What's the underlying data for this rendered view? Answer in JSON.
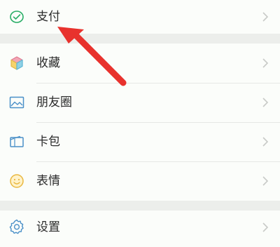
{
  "menu": {
    "items": [
      {
        "label": "支付",
        "icon": "pay-check-icon"
      },
      {
        "label": "收藏",
        "icon": "cube-icon"
      },
      {
        "label": "朋友圈",
        "icon": "image-icon"
      },
      {
        "label": "卡包",
        "icon": "wallet-icon"
      },
      {
        "label": "表情",
        "icon": "smile-icon"
      },
      {
        "label": "设置",
        "icon": "gear-icon"
      }
    ]
  },
  "colors": {
    "accent_green": "#2aae67",
    "annotation_red": "#e8322d"
  }
}
